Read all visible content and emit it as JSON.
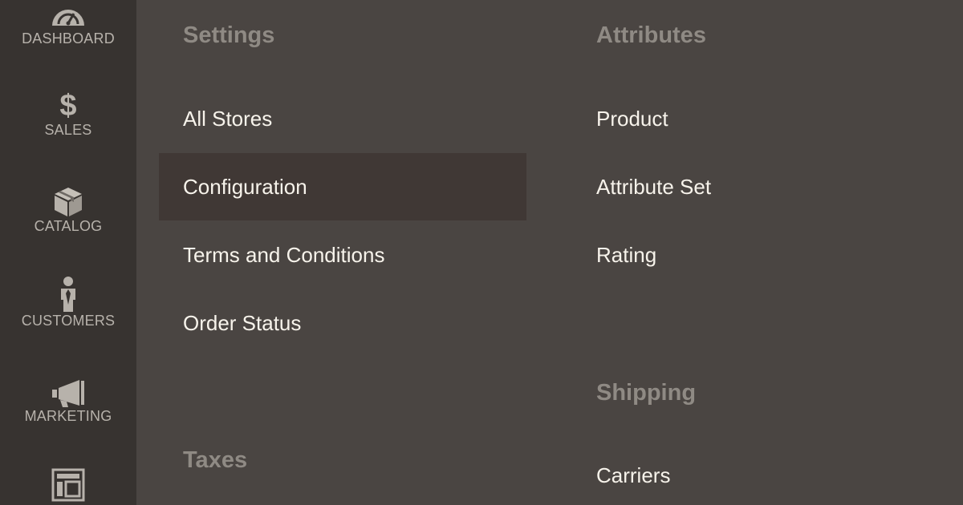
{
  "sidebar": {
    "items": [
      {
        "label": "DASHBOARD",
        "icon": "dashboard-gauge-icon"
      },
      {
        "label": "SALES",
        "icon": "dollar-icon"
      },
      {
        "label": "CATALOG",
        "icon": "box-icon"
      },
      {
        "label": "CUSTOMERS",
        "icon": "person-icon"
      },
      {
        "label": "MARKETING",
        "icon": "megaphone-icon"
      },
      {
        "label": "",
        "icon": "layout-content-icon"
      }
    ]
  },
  "menu": {
    "settings": {
      "title": "Settings",
      "links": [
        "All Stores",
        "Configuration",
        "Terms and Conditions",
        "Order Status"
      ],
      "active": "Configuration"
    },
    "taxes": {
      "title": "Taxes"
    },
    "attributes": {
      "title": "Attributes",
      "links": [
        "Product",
        "Attribute Set",
        "Rating"
      ]
    },
    "shipping": {
      "title": "Shipping",
      "links": [
        "Carriers"
      ]
    }
  },
  "colors": {
    "rail_bg": "#373330",
    "panel_bg": "#4a4542",
    "active_item_bg": "#403835",
    "section_title": "#8f8a84",
    "link_text": "#f7f3eb"
  }
}
